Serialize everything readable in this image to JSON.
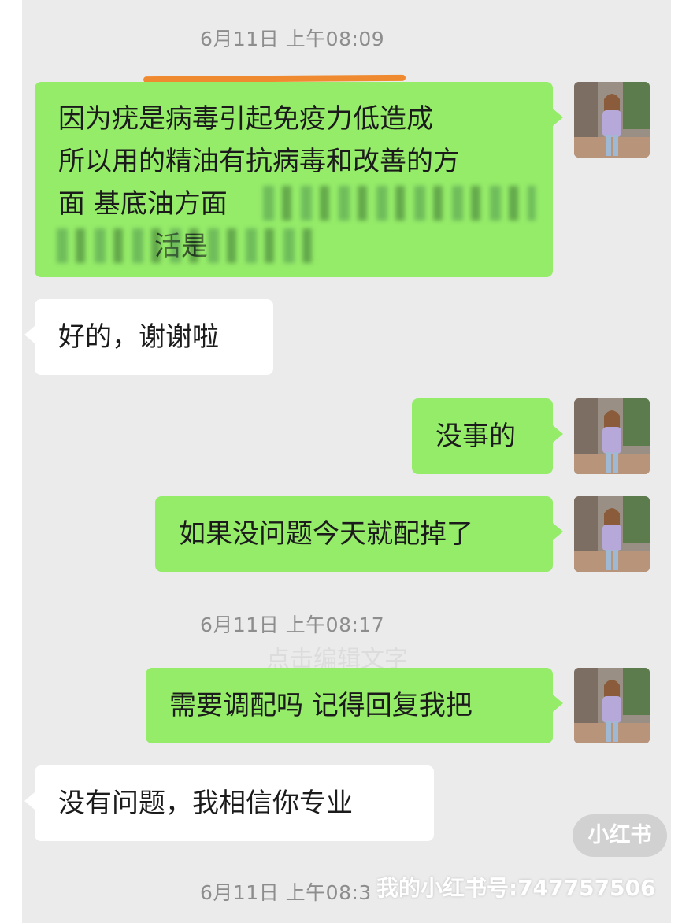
{
  "timestamps": [
    "6月11日 上午08:09",
    "6月11日 上午08:17",
    "6月11日 上午08:3"
  ],
  "messages": [
    {
      "direction": "outgoing",
      "lines": [
        "因为疣是病毒引起免疫力低造成",
        "所以用的精油有抗病毒和改善的方",
        "面 基底油方面",
        "",
        "活是"
      ]
    },
    {
      "direction": "incoming",
      "text": "好的，谢谢啦"
    },
    {
      "direction": "outgoing",
      "text": "没事的"
    },
    {
      "direction": "outgoing",
      "text": "如果没问题今天就配掉了"
    },
    {
      "direction": "outgoing",
      "text": "需要调配吗 记得回复我把"
    },
    {
      "direction": "incoming",
      "text": "没有问题，我相信你专业"
    }
  ],
  "overlay": {
    "faint_text": "点击编辑文字",
    "logo_text": "小红书",
    "account_text": "我的小红书号:747757506"
  },
  "colors": {
    "outgoing_bubble": "#95ec69",
    "incoming_bubble": "#ffffff",
    "chat_background": "#ebebeb",
    "underline": "#f08a30"
  },
  "icons": [
    "avatar-photo"
  ]
}
